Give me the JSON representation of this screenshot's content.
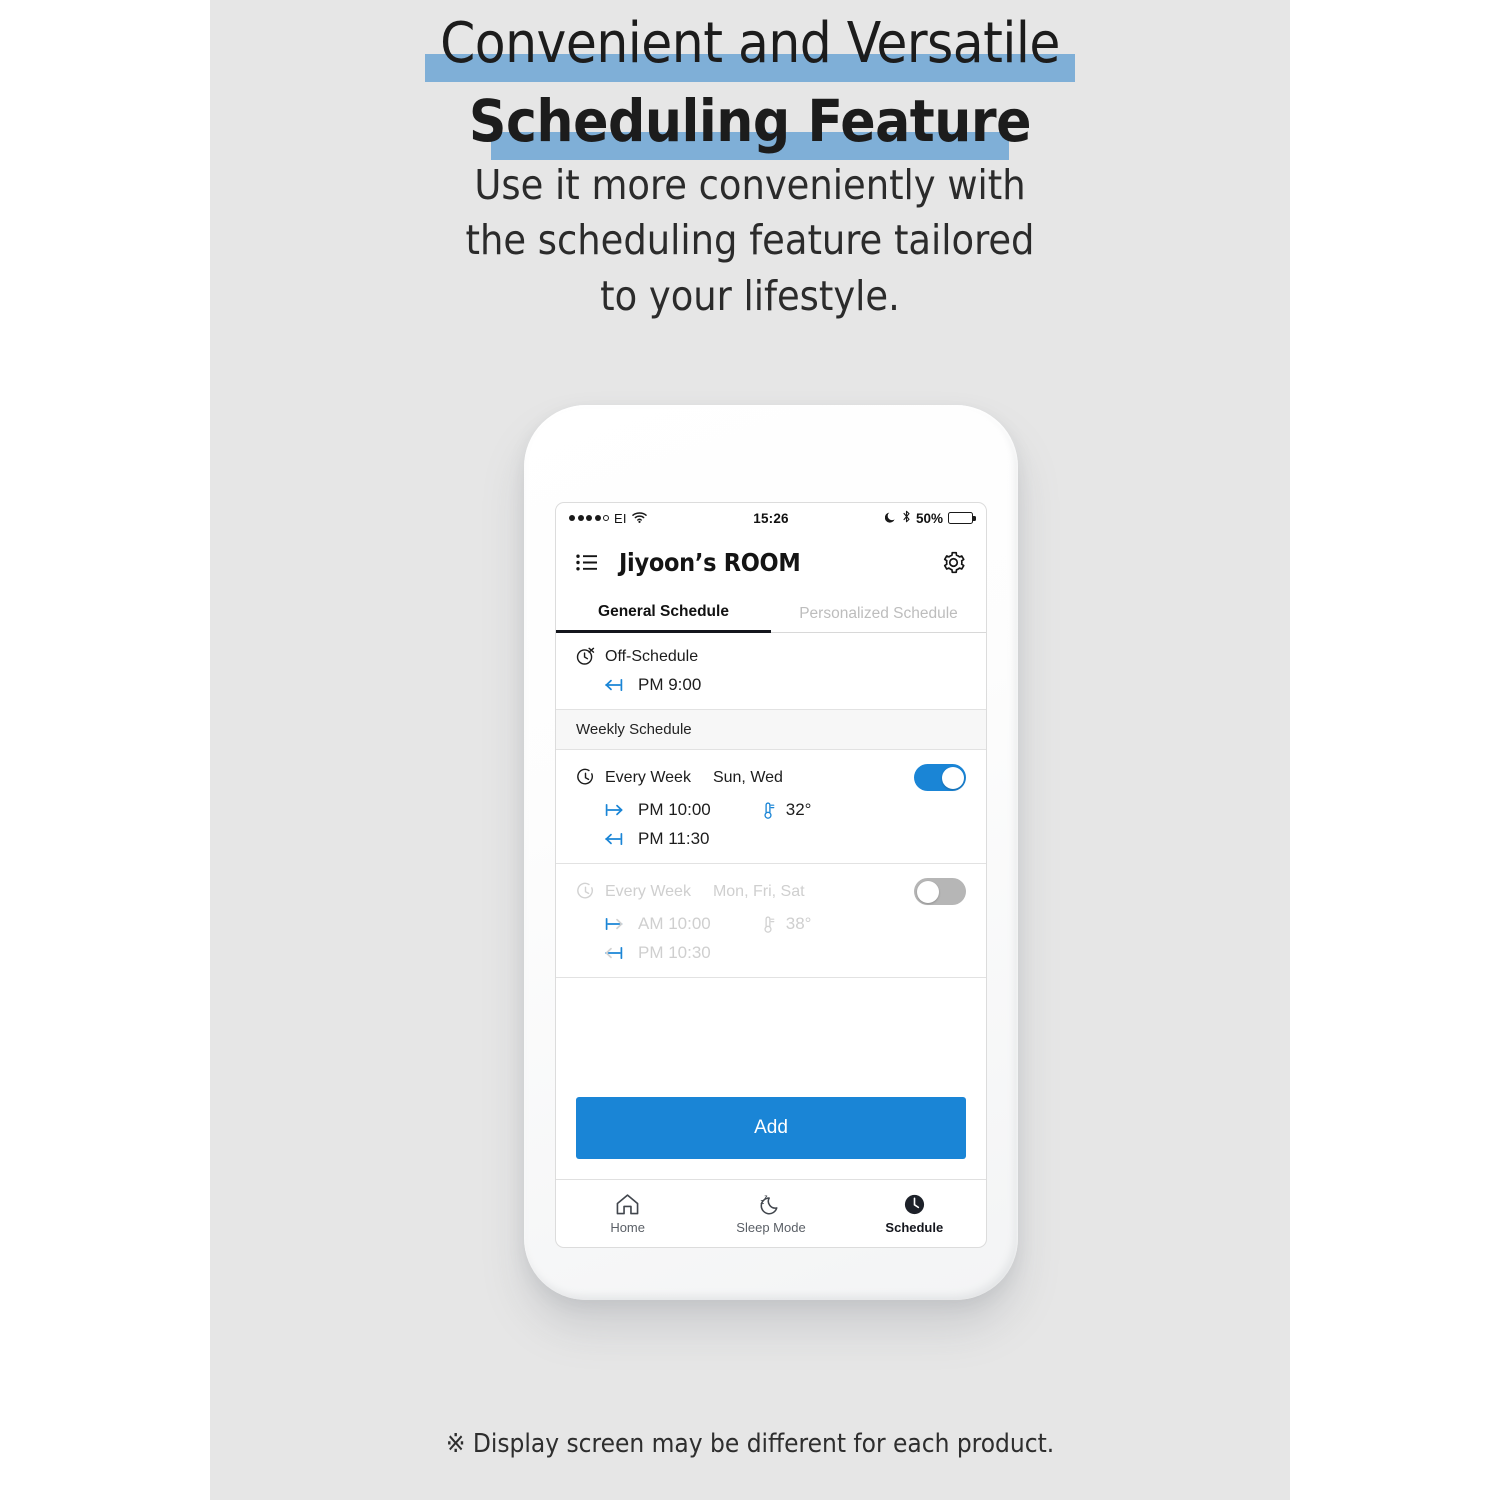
{
  "headline": {
    "line1": "Convenient and Versatile",
    "line2": "Scheduling Feature",
    "highlight_color": "#7FAFD7"
  },
  "subhead": "Use it more conveniently with\nthe scheduling feature tailored\nto your lifestyle.",
  "footnote": "※ Display screen may be different for each product.",
  "phone": {
    "status_bar": {
      "carrier": "EI",
      "signal_dots_filled": 4,
      "signal_dots_total": 5,
      "wifi": "wifi-icon",
      "time": "15:26",
      "dnd": "moon-icon",
      "bluetooth": "bluetooth-icon",
      "battery_percent": "50%",
      "battery_level": 50
    },
    "app_header": {
      "menu_icon": "list-icon",
      "title": "Jiyoon’s ROOM",
      "settings_icon": "gear-icon"
    },
    "tabs": [
      {
        "label": "General Schedule",
        "active": true
      },
      {
        "label": "Personalized Schedule",
        "active": false
      }
    ],
    "off_schedule": {
      "icon": "clock-off-icon",
      "title": "Off-Schedule",
      "end_arrow_icon": "arrow-end-icon",
      "end_time": "PM 9:00"
    },
    "weekly_section_label": "Weekly Schedule",
    "weekly_items": [
      {
        "icon": "clock-icon",
        "title": "Every Week",
        "days": "Sun, Wed",
        "enabled": true,
        "start_arrow_icon": "arrow-start-icon",
        "start_time": "PM 10:00",
        "temp_icon": "thermometer-icon",
        "temperature": "32°",
        "end_arrow_icon": "arrow-end-icon",
        "end_time": "PM 11:30"
      },
      {
        "icon": "clock-icon",
        "title": "Every Week",
        "days": "Mon, Fri, Sat",
        "enabled": false,
        "start_arrow_icon": "arrow-start-icon",
        "start_time": "AM 10:00",
        "temp_icon": "thermometer-icon",
        "temperature": "38°",
        "end_arrow_icon": "arrow-end-icon",
        "end_time": "PM 10:30"
      }
    ],
    "add_button": "Add",
    "bottom_nav": [
      {
        "icon": "home-icon",
        "label": "Home",
        "active": false
      },
      {
        "icon": "sleep-moon-icon",
        "label": "Sleep Mode",
        "active": false
      },
      {
        "icon": "clock-filled-icon",
        "label": "Schedule",
        "active": true
      }
    ],
    "accent_color": "#1A85D6",
    "toggle_off_color": "#B6B6B6"
  }
}
